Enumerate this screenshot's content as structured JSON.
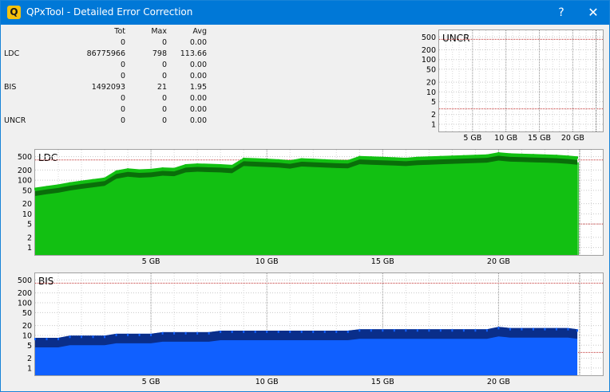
{
  "window": {
    "title": "QPxTool - Detailed Error Correction",
    "help": "?",
    "close": "✕",
    "icon": "Q"
  },
  "stats": {
    "headers": {
      "tot": "Tot",
      "max": "Max",
      "avg": "Avg"
    },
    "rows": [
      {
        "label": "",
        "tot": "0",
        "max": "0",
        "avg": "0.00"
      },
      {
        "label": "LDC",
        "tot": "86775966",
        "max": "798",
        "avg": "113.66"
      },
      {
        "label": "",
        "tot": "0",
        "max": "0",
        "avg": "0.00"
      },
      {
        "label": "",
        "tot": "0",
        "max": "0",
        "avg": "0.00"
      },
      {
        "label": "BIS",
        "tot": "1492093",
        "max": "21",
        "avg": "1.95"
      },
      {
        "label": "",
        "tot": "0",
        "max": "0",
        "avg": "0.00"
      },
      {
        "label": "",
        "tot": "0",
        "max": "0",
        "avg": "0.00"
      },
      {
        "label": "UNCR",
        "tot": "0",
        "max": "0",
        "avg": "0.00"
      }
    ]
  },
  "colors": {
    "ldc_fill": "#12c012",
    "ldc_dark": "#0a6e0a",
    "bis_fill": "#1060ff",
    "bis_dark": "#0a2e8a",
    "threshold": "#c03030"
  },
  "chart_data": [
    {
      "type": "area",
      "title": "UNCR",
      "xlabel": "",
      "ylabel": "",
      "y_scale": "log",
      "yticks": [
        "500",
        "200",
        "100",
        "50",
        "20",
        "10",
        "5",
        "2",
        "1"
      ],
      "xticks": [
        "5 GB",
        "10 GB",
        "15 GB",
        "20 GB"
      ],
      "xlim": [
        0,
        24.5
      ],
      "series": [
        {
          "x": [
            0,
            23.5
          ],
          "values": [
            0,
            0
          ]
        }
      ]
    },
    {
      "type": "area",
      "title": "LDC",
      "xlabel": "",
      "ylabel": "",
      "y_scale": "log",
      "yticks": [
        "500",
        "200",
        "100",
        "50",
        "20",
        "10",
        "5",
        "2",
        "1"
      ],
      "xticks": [
        "5 GB",
        "10 GB",
        "15 GB",
        "20 GB"
      ],
      "xlim": [
        0,
        24.5
      ],
      "series": [
        {
          "x": [
            0,
            0.5,
            1,
            1.5,
            2,
            2.5,
            3,
            3.5,
            4,
            4.5,
            5,
            5.5,
            6,
            6.5,
            7,
            7.5,
            8,
            8.5,
            9,
            9.5,
            10,
            10.5,
            11,
            11.5,
            12,
            12.5,
            13,
            13.5,
            14,
            14.5,
            15,
            15.5,
            16,
            16.5,
            17,
            17.5,
            18,
            18.5,
            19,
            19.5,
            20,
            20.5,
            21,
            21.5,
            22,
            22.5,
            23,
            23.4
          ],
          "values": [
            40,
            45,
            50,
            58,
            65,
            72,
            80,
            130,
            150,
            140,
            145,
            160,
            155,
            200,
            210,
            205,
            200,
            190,
            310,
            300,
            290,
            280,
            260,
            300,
            290,
            280,
            270,
            265,
            350,
            340,
            330,
            320,
            310,
            330,
            340,
            350,
            360,
            370,
            380,
            390,
            450,
            420,
            410,
            400,
            390,
            380,
            360,
            340
          ]
        }
      ]
    },
    {
      "type": "area",
      "title": "BIS",
      "xlabel": "",
      "ylabel": "",
      "y_scale": "log",
      "yticks": [
        "500",
        "200",
        "100",
        "50",
        "20",
        "10",
        "5",
        "2",
        "1"
      ],
      "xticks": [
        "5 GB",
        "10 GB",
        "15 GB",
        "20 GB"
      ],
      "xlim": [
        0,
        24.5
      ],
      "series": [
        {
          "x": [
            0,
            0.5,
            1,
            1.5,
            2,
            2.5,
            3,
            3.5,
            4,
            4.5,
            5,
            5.5,
            6,
            6.5,
            7,
            7.5,
            8,
            8.5,
            9,
            9.5,
            10,
            10.5,
            11,
            11.5,
            12,
            12.5,
            13,
            13.5,
            14,
            14.5,
            15,
            15.5,
            16,
            16.5,
            17,
            17.5,
            18,
            18.5,
            19,
            19.5,
            20,
            20.5,
            21,
            21.5,
            22,
            22.5,
            23,
            23.4
          ],
          "values": [
            6,
            6,
            6,
            7,
            7,
            7,
            7,
            8,
            8,
            8,
            8,
            9,
            9,
            9,
            9,
            9,
            10,
            10,
            10,
            10,
            10,
            10,
            10,
            10,
            10,
            10,
            10,
            10,
            11,
            11,
            11,
            11,
            11,
            11,
            11,
            11,
            11,
            11,
            11,
            11,
            13,
            12,
            12,
            12,
            12,
            12,
            12,
            11
          ]
        }
      ]
    }
  ]
}
